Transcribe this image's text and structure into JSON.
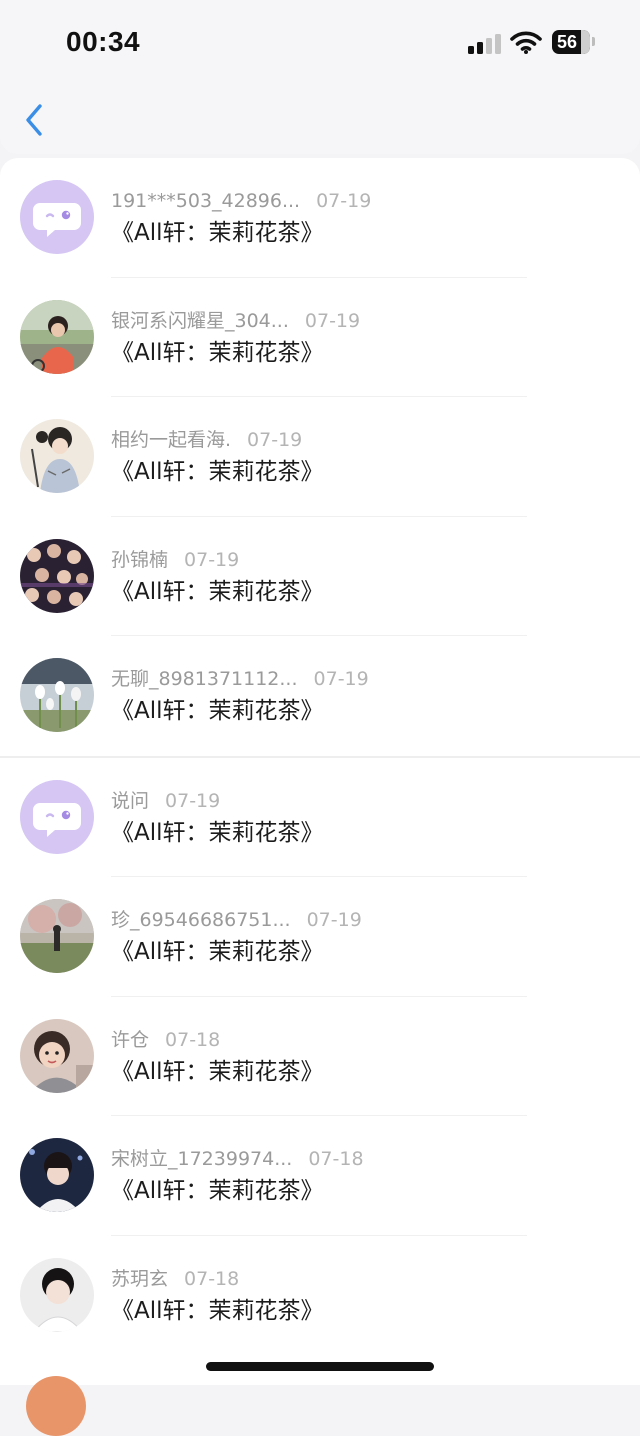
{
  "status_bar": {
    "time": "00:34",
    "battery_level": "56",
    "signal_bars": 2
  },
  "nav": {
    "back_icon": "chevron-left-icon",
    "accent_color": "#3a8ee6"
  },
  "comments": [
    {
      "name": "191***503_42896...",
      "date": "07-19",
      "title": "《All轩：茉莉花茶》",
      "avatar": "chat-bubble-default"
    },
    {
      "name": "银河系闪耀星_304...",
      "date": "07-19",
      "title": "《All轩：茉莉花茶》",
      "avatar": "photo-person-outdoor"
    },
    {
      "name": "相约一起看海.",
      "date": "07-19",
      "title": "《All轩：茉莉花茶》",
      "avatar": "illustration-girl"
    },
    {
      "name": "孙锦楠",
      "date": "07-19",
      "title": "《All轩：茉莉花茶》",
      "avatar": "photo-group"
    },
    {
      "name": "无聊_8981371112...",
      "date": "07-19",
      "title": "《All轩：茉莉花茶》",
      "avatar": "photo-flowers"
    },
    {
      "name": "说问",
      "date": "07-19",
      "title": "《All轩：茉莉花茶》",
      "avatar": "chat-bubble-default"
    },
    {
      "name": "珍_69546686751...",
      "date": "07-19",
      "title": "《All轩：茉莉花茶》",
      "avatar": "photo-park"
    },
    {
      "name": "许仓",
      "date": "07-18",
      "title": "《All轩：茉莉花茶》",
      "avatar": "photo-child"
    },
    {
      "name": "宋树立_17239974...",
      "date": "07-18",
      "title": "《All轩：茉莉花茶》",
      "avatar": "photo-person-dark"
    },
    {
      "name": "苏玥玄",
      "date": "07-18",
      "title": "《All轩：茉莉花茶》",
      "avatar": "photo-person-portrait"
    }
  ]
}
